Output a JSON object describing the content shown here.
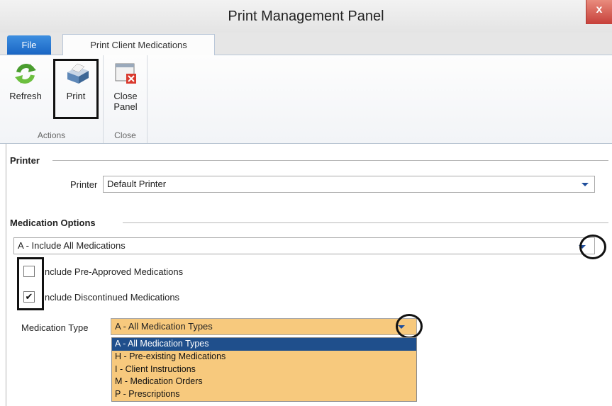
{
  "window": {
    "title": "Print Management Panel",
    "close_glyph": "x"
  },
  "tabs": {
    "file": "File",
    "active": "Print Client Medications"
  },
  "ribbon": {
    "refresh": "Refresh",
    "print": "Print",
    "close_panel_line1": "Close",
    "close_panel_line2": "Panel",
    "group_actions": "Actions",
    "group_close": "Close",
    "icons": [
      "refresh-icon",
      "printer-icon",
      "close-panel-icon"
    ]
  },
  "printer_section": {
    "header": "Printer",
    "printer_label": "Printer",
    "printer_value": "Default Printer"
  },
  "medication_options": {
    "header": "Medication Options",
    "include_value": "A - Include All Medications",
    "pre_approved_label": "nclude Pre-Approved Medications",
    "pre_approved_checked": false,
    "discontinued_label": "nclude Discontinued Medications",
    "discontinued_checked": true,
    "check_glyph": "✔",
    "medication_type_label": "Medication Type",
    "medication_type_value": "A - All Medication Types",
    "medication_type_options": [
      "A - All Medication Types",
      "H - Pre-existing Medications",
      "I - Client Instructions",
      "M - Medication Orders",
      "P - Prescriptions"
    ],
    "selected_index": 0
  },
  "colors": {
    "file_tab": "#1a66c4",
    "dropdown_bg": "#f7c97d",
    "selected_item": "#1f4f8c",
    "close_button": "#c7403a"
  }
}
